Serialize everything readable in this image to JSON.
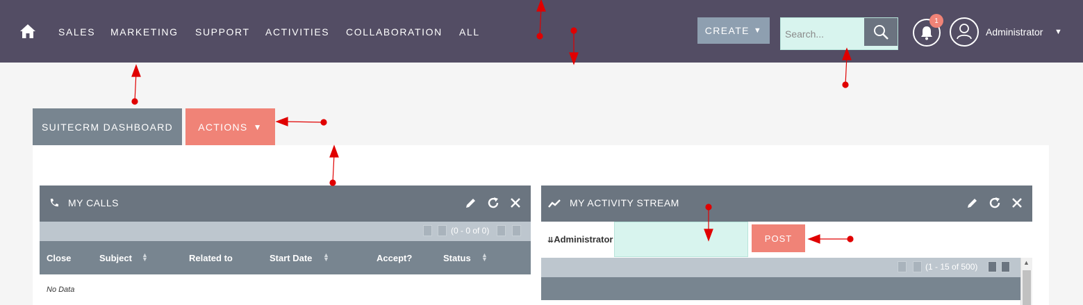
{
  "nav": {
    "items": [
      {
        "label": "SALES",
        "name": "nav-item-sales"
      },
      {
        "label": "MARKETING",
        "name": "nav-item-marketing"
      },
      {
        "label": "SUPPORT",
        "name": "nav-item-support"
      },
      {
        "label": "ACTIVITIES",
        "name": "nav-item-activities"
      },
      {
        "label": "COLLABORATION",
        "name": "nav-item-collaboration"
      },
      {
        "label": "ALL",
        "name": "nav-item-all"
      }
    ],
    "create_label": "CREATE",
    "search_placeholder": "Search...",
    "notification_count": "1",
    "user_name": "Administrator"
  },
  "tabs": {
    "dashboard_label": "SUITECRM DASHBOARD",
    "actions_label": "ACTIONS"
  },
  "my_calls": {
    "title": "MY CALLS",
    "pager": "(0 - 0 of 0)",
    "columns": [
      "Close",
      "Subject",
      "Related to",
      "Start Date",
      "Accept?",
      "Status"
    ],
    "no_data": "No Data"
  },
  "activity_stream": {
    "title": "MY ACTIVITY STREAM",
    "user": "Administrator",
    "post_label": "POST",
    "pager": "(1 - 15 of 500)"
  },
  "colors": {
    "topbar": "#534d64",
    "accent": "#f08377",
    "dashlet_header": "#6b7580",
    "input_bg": "#d8f4ee"
  }
}
